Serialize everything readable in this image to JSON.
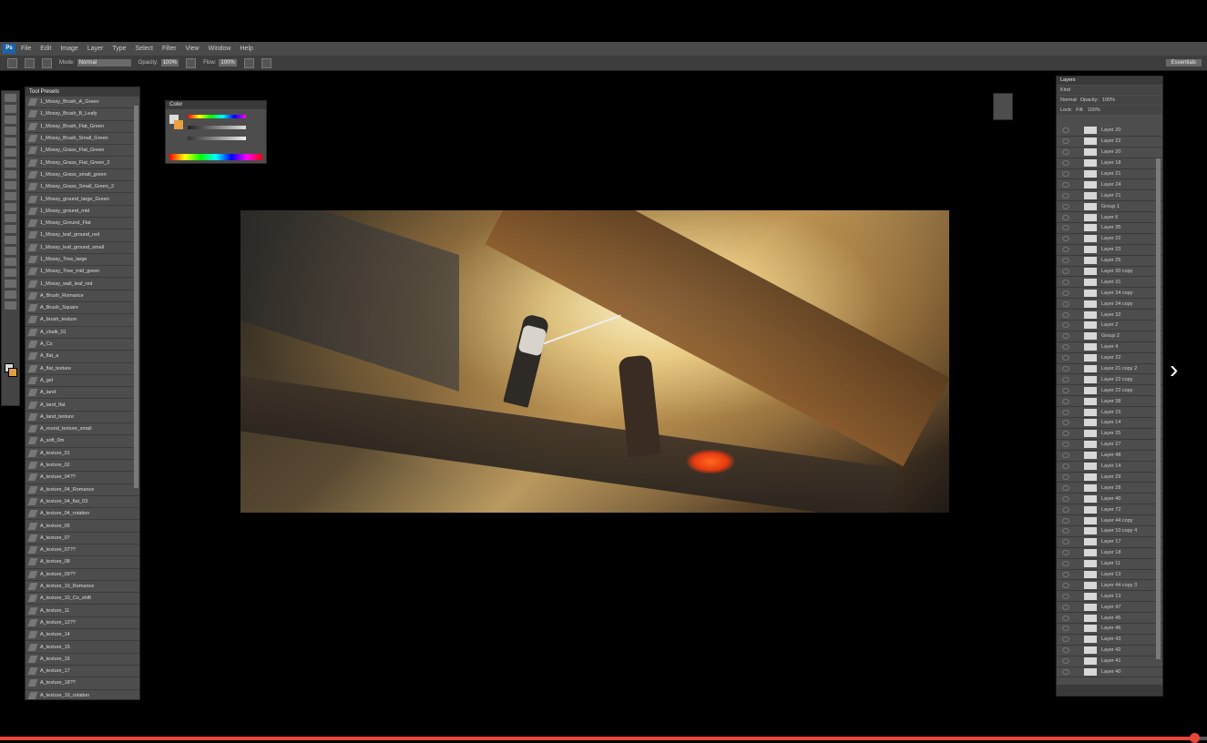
{
  "app": {
    "logo": "Ps",
    "menu": [
      "File",
      "Edit",
      "Image",
      "Layer",
      "Type",
      "Select",
      "Filter",
      "View",
      "Window",
      "Help"
    ]
  },
  "options": {
    "mode_label": "Mode:",
    "mode_value": "Normal",
    "opacity_label": "Opacity:",
    "opacity_value": "100%",
    "flow_label": "Flow:",
    "flow_value": "100%",
    "workspace": "Essentials"
  },
  "presets": {
    "tab": "Tool Presets",
    "items": [
      "1_Mossy_Brush_A_Green",
      "1_Mossy_Brush_B_Leafy",
      "1_Mossy_Brush_Flat_Green",
      "1_Mossy_Brush_Small_Green",
      "1_Mossy_Grass_Flat_Green",
      "1_Mossy_Grass_Flat_Green_2",
      "1_Mossy_Grass_small_green",
      "1_Mossy_Grass_Small_Green_2",
      "1_Mossy_ground_large_Green",
      "1_Mossy_ground_mid",
      "1_Mossy_Ground_Flat",
      "1_Mossy_leaf_ground_red",
      "1_Mossy_leaf_ground_small",
      "1_Mossy_Tree_large",
      "1_Mossy_Tree_mid_green",
      "1_Mossy_wall_leaf_red",
      "A_Brush_Romance",
      "A_Brush_Square",
      "A_brush_texture",
      "A_chalk_01",
      "A_Cs",
      "A_flat_a",
      "A_flat_texture",
      "A_gel",
      "A_land",
      "A_land_flat",
      "A_land_texture",
      "A_round_texture_small",
      "A_soft_0m",
      "A_texture_01",
      "A_texture_02",
      "A_texture_04??",
      "A_texture_04_Romance",
      "A_texture_04_flat_03",
      "A_texture_04_rotation",
      "A_texture_05",
      "A_texture_07",
      "A_texture_07??",
      "A_texture_08",
      "A_texture_09??",
      "A_texture_10_Romance",
      "A_texture_10_Co_shift",
      "A_texture_11",
      "A_texture_12??",
      "A_texture_14",
      "A_texture_15",
      "A_texture_16",
      "A_texture_17",
      "A_texture_18??",
      "A_texture_19_rotation",
      "A_texture_20"
    ]
  },
  "color_panel": {
    "tab": "Color",
    "fg": "#dddddd",
    "bg": "#e8a040"
  },
  "layers_panel": {
    "tab": "Layers",
    "kind": "Kind",
    "blend": "Normal",
    "opacity_label": "Opacity:",
    "opacity": "100%",
    "lock_label": "Lock:",
    "fill_label": "Fill:",
    "fill": "100%",
    "layers": [
      "Layer 20",
      "Layer 22",
      "Layer 20",
      "Layer 18",
      "Layer 21",
      "Layer 24",
      "Layer 21",
      "Group 1",
      "Layer 6",
      "Layer 35",
      "Layer 22",
      "Layer 23",
      "Layer 25",
      "Layer 30 copy",
      "Layer 31",
      "Layer 34 copy",
      "Layer 34 copy",
      "Layer 32",
      "Layer 2",
      "Group 2",
      "Layer 4",
      "Layer 22",
      "Layer 21 copy 2",
      "Layer 22 copy",
      "Layer 22 copy",
      "Layer 38",
      "Layer 15",
      "Layer 14",
      "Layer 25",
      "Layer 27",
      "Layer 48",
      "Layer 14",
      "Layer 29",
      "Layer 28",
      "Layer 40",
      "Layer 72",
      "Layer 44 copy",
      "Layer 10 copy 4",
      "Layer 17",
      "Layer 18",
      "Layer 11",
      "Layer 13",
      "Layer 44 copy 3",
      "Layer 13",
      "Layer 47",
      "Layer 45",
      "Layer 46",
      "Layer 43",
      "Layer 42",
      "Layer 41",
      "Layer 40"
    ]
  },
  "video_progress_fraction": 0.99
}
